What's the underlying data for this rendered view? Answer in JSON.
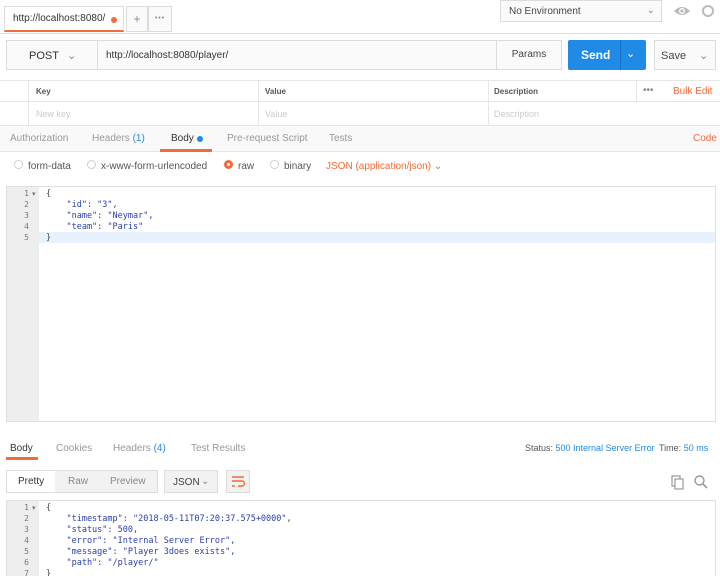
{
  "tabs": {
    "request_tab_title": "http://localhost:8080/",
    "new_tab": "+",
    "more_tabs": "•••"
  },
  "environment": {
    "selected": "No Environment"
  },
  "request": {
    "method": "POST",
    "url": "http://localhost:8080/player/",
    "params_label": "Params",
    "send_label": "Send",
    "save_label": "Save"
  },
  "params_table": {
    "headers": {
      "key": "Key",
      "value": "Value",
      "description": "Description"
    },
    "placeholders": {
      "key": "New key",
      "value": "Value",
      "description": "Description"
    },
    "more": "•••",
    "bulk_edit": "Bulk Edit"
  },
  "request_tabs": {
    "authorization": "Authorization",
    "headers": "Headers",
    "headers_count": "(1)",
    "body": "Body",
    "pre_request": "Pre-request Script",
    "tests": "Tests",
    "code": "Code"
  },
  "body_types": {
    "form_data": "form-data",
    "urlencoded": "x-www-form-urlencoded",
    "raw": "raw",
    "binary": "binary",
    "selected": "raw",
    "content_type": "JSON (application/json)"
  },
  "request_body": {
    "lines": [
      "1",
      "2",
      "3",
      "4",
      "5"
    ],
    "code": [
      "{",
      "    \"id\": \"3\",",
      "    \"name\": \"Neymar\",",
      "    \"team\": \"Paris\"",
      "}"
    ]
  },
  "response_tabs": {
    "body": "Body",
    "cookies": "Cookies",
    "headers": "Headers",
    "headers_count": "(4)",
    "test_results": "Test Results"
  },
  "response_status": {
    "status_label": "Status:",
    "status_value": "500 Internal Server Error",
    "time_label": "Time:",
    "time_value": "50 ms"
  },
  "response_view": {
    "pretty": "Pretty",
    "raw": "Raw",
    "preview": "Preview",
    "format": "JSON"
  },
  "response_body": {
    "lines": [
      "1",
      "2",
      "3",
      "4",
      "5",
      "6",
      "7"
    ],
    "code": [
      "{",
      "    \"timestamp\": \"2018-05-11T07:20:37.575+0000\",",
      "    \"status\": 500,",
      "    \"error\": \"Internal Server Error\",",
      "    \"message\": \"Player 3does exists\",",
      "    \"path\": \"/player/\"",
      "}"
    ]
  },
  "colors": {
    "accent": "#f26b3a",
    "primary": "#1f8be6",
    "status_error": "#1f8be6"
  }
}
